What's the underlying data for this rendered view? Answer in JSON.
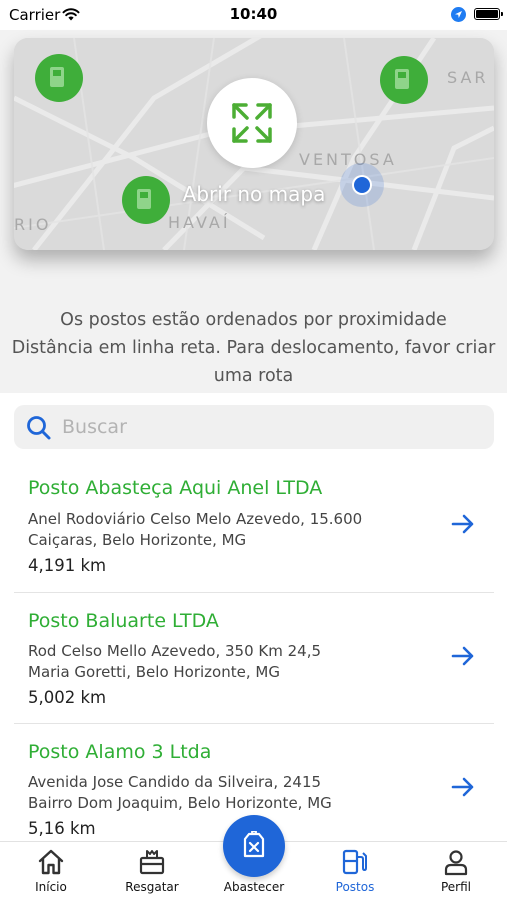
{
  "status_bar": {
    "carrier": "Carrier",
    "time": "10:40",
    "icons": [
      "wifi-icon",
      "location-arrow-icon",
      "battery-icon"
    ]
  },
  "map_preview": {
    "button_label": "Abrir no mapa",
    "street_labels": [
      "VENTOSA",
      "HAVAÍ",
      "RIO",
      "SAR"
    ],
    "icon": "expand-arrows-icon",
    "marker_color": "#3fae3a",
    "user_dot_color": "#1f66d8"
  },
  "info": {
    "line1": "Os postos estão ordenados por proximidade",
    "line2": "Distância em linha reta. Para deslocamento, favor criar uma rota"
  },
  "search": {
    "placeholder": "Buscar",
    "icon": "search-icon"
  },
  "stations": [
    {
      "name": "Posto Abasteça Aqui Anel LTDA",
      "address_line1": "Anel Rodoviário Celso Melo Azevedo, 15.600",
      "address_line2": "Caiçaras, Belo Horizonte, MG",
      "distance": "4,191 km"
    },
    {
      "name": "Posto Baluarte LTDA",
      "address_line1": "Rod Celso Mello Azevedo, 350 Km 24,5",
      "address_line2": "Maria Goretti, Belo Horizonte, MG",
      "distance": "5,002 km"
    },
    {
      "name": "Posto Alamo 3 Ltda",
      "address_line1": "Avenida Jose Candido da Silveira, 2415",
      "address_line2": "Bairro Dom Joaquim, Belo Horizonte, MG",
      "distance": "5,16 km"
    }
  ],
  "tab_bar": {
    "tabs": [
      {
        "label": "Início",
        "icon": "home-icon"
      },
      {
        "label": "Resgatar",
        "icon": "gift-icon"
      },
      {
        "label": "Abastecer",
        "icon": "fuel-can-icon"
      },
      {
        "label": "Postos",
        "icon": "gas-station-icon",
        "active": true
      },
      {
        "label": "Perfil",
        "icon": "user-icon"
      }
    ],
    "active_color": "#1f66d8"
  },
  "colors": {
    "accent_green": "#2fae35",
    "accent_blue": "#1f66d8"
  }
}
